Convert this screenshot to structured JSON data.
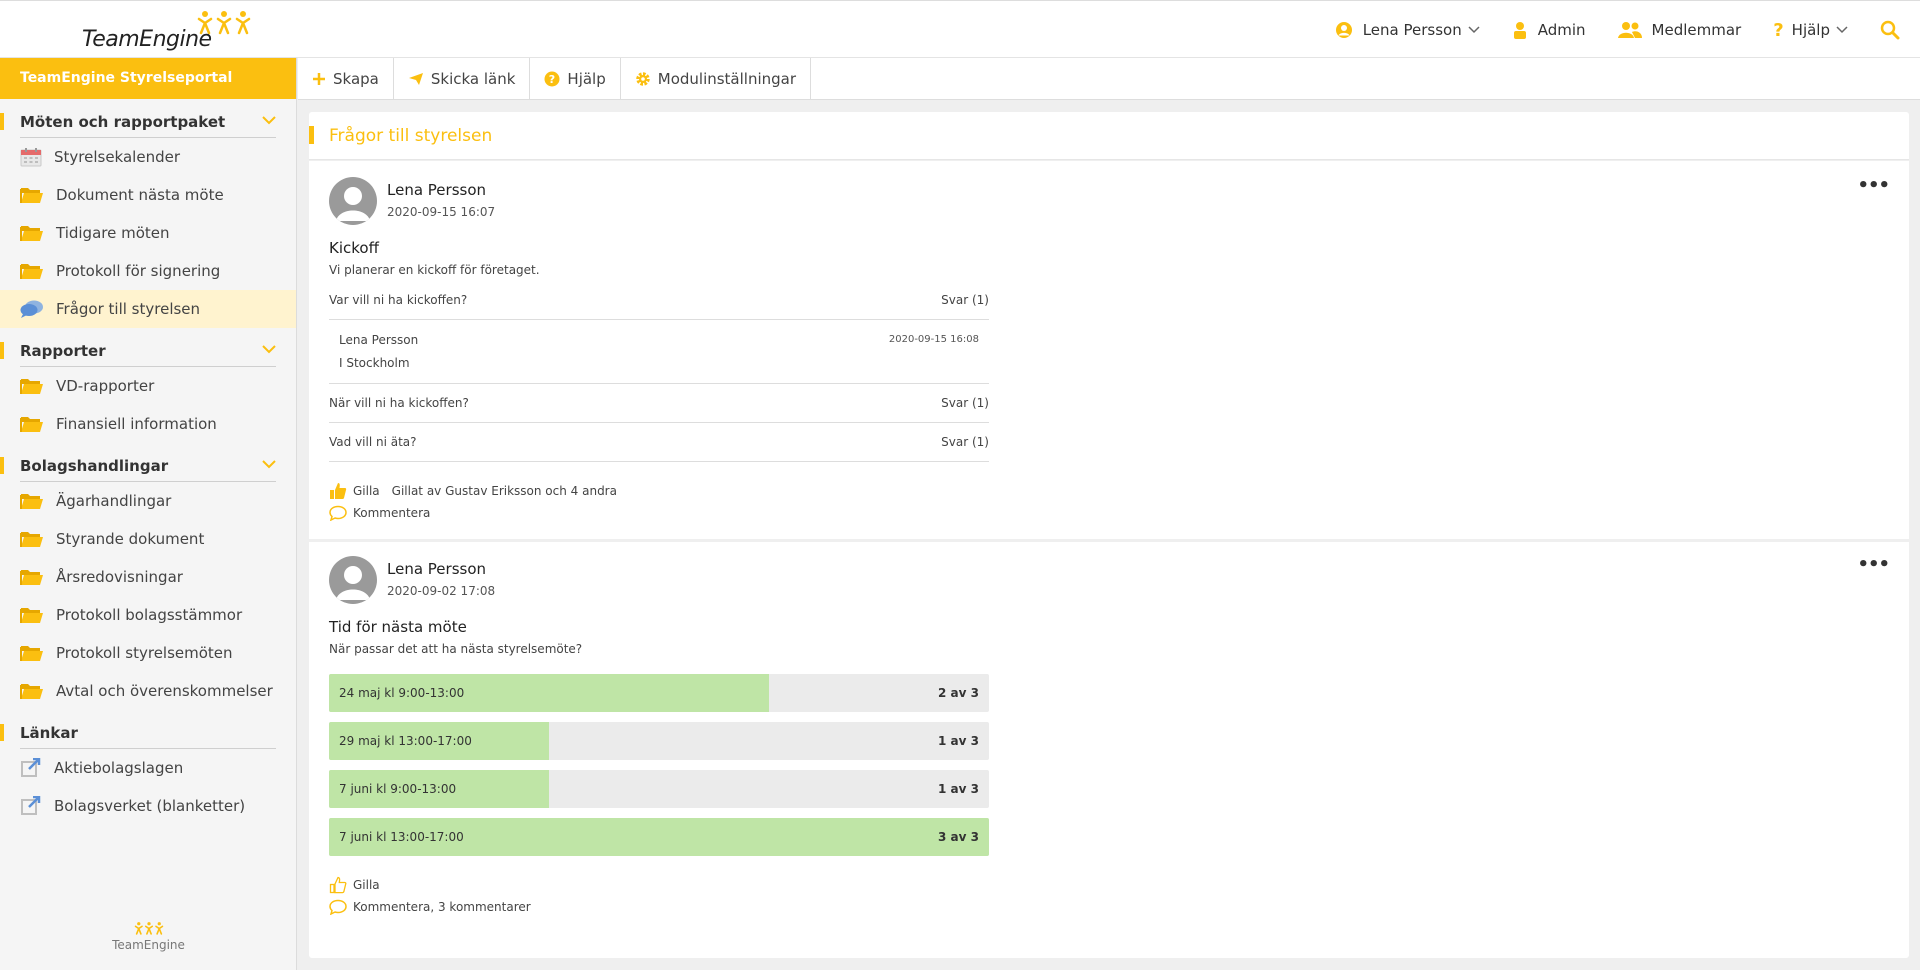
{
  "brand": {
    "name": "TeamEngine",
    "accent": "#fbbf10"
  },
  "header": {
    "user_name": "Lena Persson",
    "admin_label": "Admin",
    "members_label": "Medlemmar",
    "help_label": "Hjälp"
  },
  "sidebar": {
    "portal_title": "TeamEngine Styrelseportal",
    "sections": [
      {
        "title": "Möten och rapportpaket",
        "items": [
          {
            "label": "Styrelsekalender",
            "icon": "calendar-icon"
          },
          {
            "label": "Dokument nästa möte",
            "icon": "folder-icon"
          },
          {
            "label": "Tidigare möten",
            "icon": "folder-icon"
          },
          {
            "label": "Protokoll för signering",
            "icon": "folder-icon"
          },
          {
            "label": "Frågor till styrelsen",
            "icon": "chat-icon",
            "active": true
          }
        ]
      },
      {
        "title": "Rapporter",
        "items": [
          {
            "label": "VD-rapporter",
            "icon": "folder-icon"
          },
          {
            "label": "Finansiell information",
            "icon": "folder-icon"
          }
        ]
      },
      {
        "title": "Bolagshandlingar",
        "items": [
          {
            "label": "Ägarhandlingar",
            "icon": "folder-icon"
          },
          {
            "label": "Styrande dokument",
            "icon": "folder-icon"
          },
          {
            "label": "Årsredovisningar",
            "icon": "folder-icon"
          },
          {
            "label": "Protokoll bolagsstämmor",
            "icon": "folder-icon"
          },
          {
            "label": "Protokoll styrelsemöten",
            "icon": "folder-icon"
          },
          {
            "label": "Avtal och överenskommelser",
            "icon": "folder-icon"
          }
        ]
      },
      {
        "title": "Länkar",
        "items": [
          {
            "label": "Aktiebolagslagen",
            "icon": "external-link-icon"
          },
          {
            "label": "Bolagsverket (blanketter)",
            "icon": "external-link-icon"
          }
        ]
      }
    ],
    "footer": "TeamEngine"
  },
  "toolbar": {
    "create_label": "Skapa",
    "send_link_label": "Skicka länk",
    "help_label": "Hjälp",
    "module_settings_label": "Modulinställningar"
  },
  "main": {
    "title": "Frågor till styrelsen",
    "posts": [
      {
        "author": "Lena Persson",
        "timestamp": "2020-09-15 16:07",
        "title": "Kickoff",
        "description": "Vi planerar en kickoff för företaget.",
        "questions": [
          {
            "question": "Var vill ni ha kickoffen?",
            "answers_label": "Svar (1)",
            "answer": {
              "author": "Lena Persson",
              "timestamp": "2020-09-15 16:08",
              "text": "I Stockholm"
            }
          },
          {
            "question": "När vill ni ha kickoffen?",
            "answers_label": "Svar (1)"
          },
          {
            "question": "Vad vill ni äta?",
            "answers_label": "Svar (1)"
          }
        ],
        "like_label": "Gilla",
        "liked_by": "Gillat av Gustav Eriksson och 4 andra",
        "comment_label": "Kommentera"
      },
      {
        "author": "Lena Persson",
        "timestamp": "2020-09-02 17:08",
        "title": "Tid för nästa möte",
        "description": "När passar det att ha nästa styrelsemöte?",
        "poll": [
          {
            "label": "24 maj kl 9:00-13:00",
            "count_label": "2 av 3",
            "fraction": 0.667
          },
          {
            "label": "29 maj kl 13:00-17:00",
            "count_label": "1 av 3",
            "fraction": 0.333
          },
          {
            "label": "7 juni kl 9:00-13:00",
            "count_label": "1 av 3",
            "fraction": 0.333
          },
          {
            "label": "7 juni kl 13:00-17:00",
            "count_label": "3 av 3",
            "fraction": 1.0
          }
        ],
        "like_label": "Gilla",
        "comment_label": "Kommentera, 3 kommentarer"
      }
    ]
  }
}
